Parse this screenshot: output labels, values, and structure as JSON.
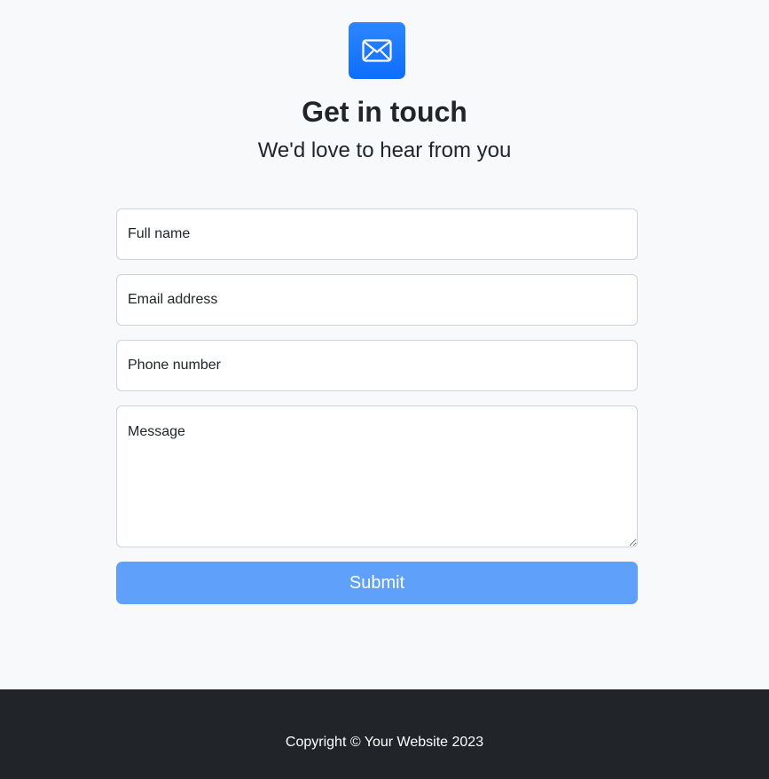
{
  "header": {
    "icon": "envelope-icon",
    "title": "Get in touch",
    "subtitle": "We'd love to hear from you"
  },
  "form": {
    "full_name": {
      "placeholder": "Full name",
      "value": ""
    },
    "email": {
      "placeholder": "Email address",
      "value": ""
    },
    "phone": {
      "placeholder": "Phone number",
      "value": ""
    },
    "message": {
      "placeholder": "Message",
      "value": ""
    },
    "submit_label": "Submit"
  },
  "footer": {
    "copyright": "Copyright © Your Website 2023"
  },
  "colors": {
    "page_background": "#f8f9fa",
    "icon_tile": "#0d6efd",
    "submit_button": "#5fa0fa",
    "footer_background": "#212529",
    "text": "#212529",
    "field_border": "#ced4da"
  }
}
